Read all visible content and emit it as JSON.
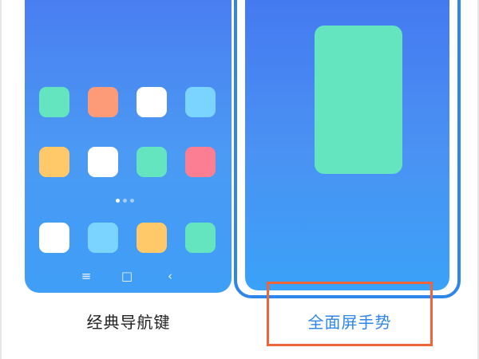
{
  "options": {
    "classic": {
      "label": "经典导航键",
      "app_icon_colors": [
        "#65e5bf",
        "#fd9a78",
        "#ffffff",
        "#7bd4ff",
        "#ffc96a",
        "#ffffff",
        "#65e5bf",
        "#fb7e93",
        "#ffffff",
        "#7bd4ff",
        "#ffc96a",
        "#65e5bf"
      ],
      "nav_keys": [
        {
          "icon": "menu-icon",
          "glyph": "≡"
        },
        {
          "icon": "home-icon",
          "glyph": "□"
        },
        {
          "icon": "back-icon",
          "glyph": "‹"
        }
      ]
    },
    "gesture": {
      "label": "全面屏手势",
      "selected": true
    }
  },
  "colors": {
    "selected_accent": "#2f86ea",
    "highlight": "#f0643a",
    "screen_blue": "#4a8cf2",
    "card_green": "#65e5bf"
  }
}
